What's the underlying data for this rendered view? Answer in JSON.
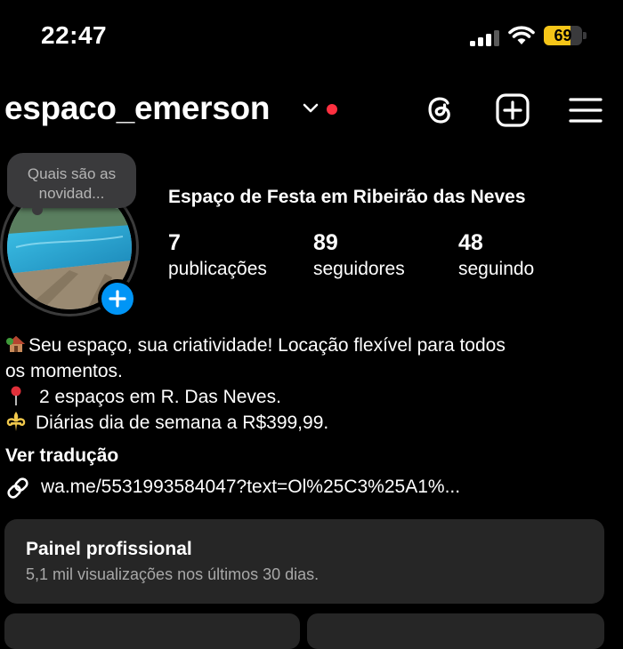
{
  "status_bar": {
    "time": "22:47",
    "battery": "69",
    "battery_level": 0.69,
    "battery_color": "#f5c518",
    "icons": [
      "cellular-signal-icon",
      "wifi-icon",
      "battery-icon"
    ]
  },
  "header": {
    "username": "espaco_emerson",
    "icons": [
      "chevron-down-icon",
      "threads-icon",
      "add-post-icon",
      "hamburger-menu-icon"
    ]
  },
  "profile": {
    "note": "Quais são as novidad...",
    "display_name": "Espaço de Festa em Ribeirão das Neves",
    "stats": {
      "posts_count": "7",
      "posts_label": "publicações",
      "followers_count": "89",
      "followers_label": "seguidores",
      "following_count": "48",
      "following_label": "seguindo"
    }
  },
  "bio": {
    "line1": "Seu espaço, sua criatividade! Locação flexível para todos",
    "line2": "os momentos.",
    "line3": "2 espaços em R. Das Neves.",
    "line4": "Diárias dia de semana a R$399,99.",
    "icons": [
      "house-emoji-icon",
      "pin-emoji-icon",
      "fleur-de-lis-icon"
    ],
    "translate": "Ver tradução",
    "link": "wa.me/5531993584047?text=Ol%25C3%25A1%..."
  },
  "dashboard": {
    "title": "Painel profissional",
    "subtitle": "5,1 mil visualizações nos últimos 30 dias."
  },
  "colors": {
    "accent_blue": "#0095f6",
    "notification_red": "#ff3040",
    "card_background": "#262626"
  }
}
